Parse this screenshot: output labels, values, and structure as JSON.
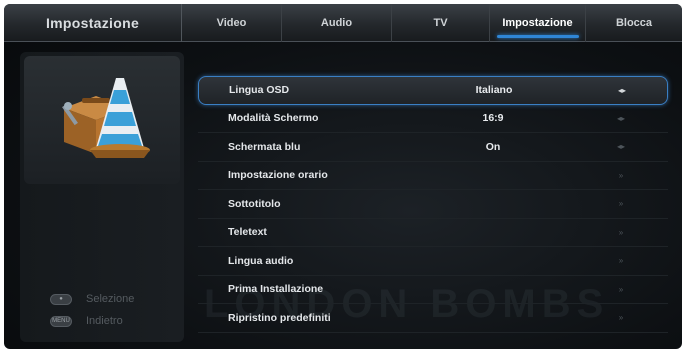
{
  "header": {
    "section_title": "Impostazione",
    "tabs": [
      {
        "label": "Video"
      },
      {
        "label": "Audio"
      },
      {
        "label": "TV"
      },
      {
        "label": "Impostazione"
      },
      {
        "label": "Blocca"
      }
    ],
    "active_tab": "Impostazione"
  },
  "sidebar": {
    "icon": "toolbox-cone-icon",
    "hints": [
      {
        "key_icon": "ok-key-icon",
        "label": "Selezione"
      },
      {
        "key_icon": "menu-key-icon",
        "label": "Indietro"
      }
    ]
  },
  "menu": {
    "items": [
      {
        "label": "Lingua OSD",
        "value": "Italiano",
        "control": "left-right",
        "selected": true
      },
      {
        "label": "Modalità Schermo",
        "value": "16:9",
        "control": "left-right"
      },
      {
        "label": "Schermata blu",
        "value": "On",
        "control": "left-right"
      },
      {
        "label": "Impostazione orario",
        "value": "",
        "control": "submenu"
      },
      {
        "label": "Sottotitolo",
        "value": "",
        "control": "submenu"
      },
      {
        "label": "Teletext",
        "value": "",
        "control": "submenu"
      },
      {
        "label": "Lingua audio",
        "value": "",
        "control": "submenu"
      },
      {
        "label": "Prima Installazione",
        "value": "",
        "control": "submenu"
      },
      {
        "label": "Ripristino predefiniti",
        "value": "",
        "control": "submenu"
      }
    ]
  },
  "colors": {
    "accent": "#2f86d6",
    "selection_border": "#3a7fc4",
    "text": "#e4e7ea"
  }
}
